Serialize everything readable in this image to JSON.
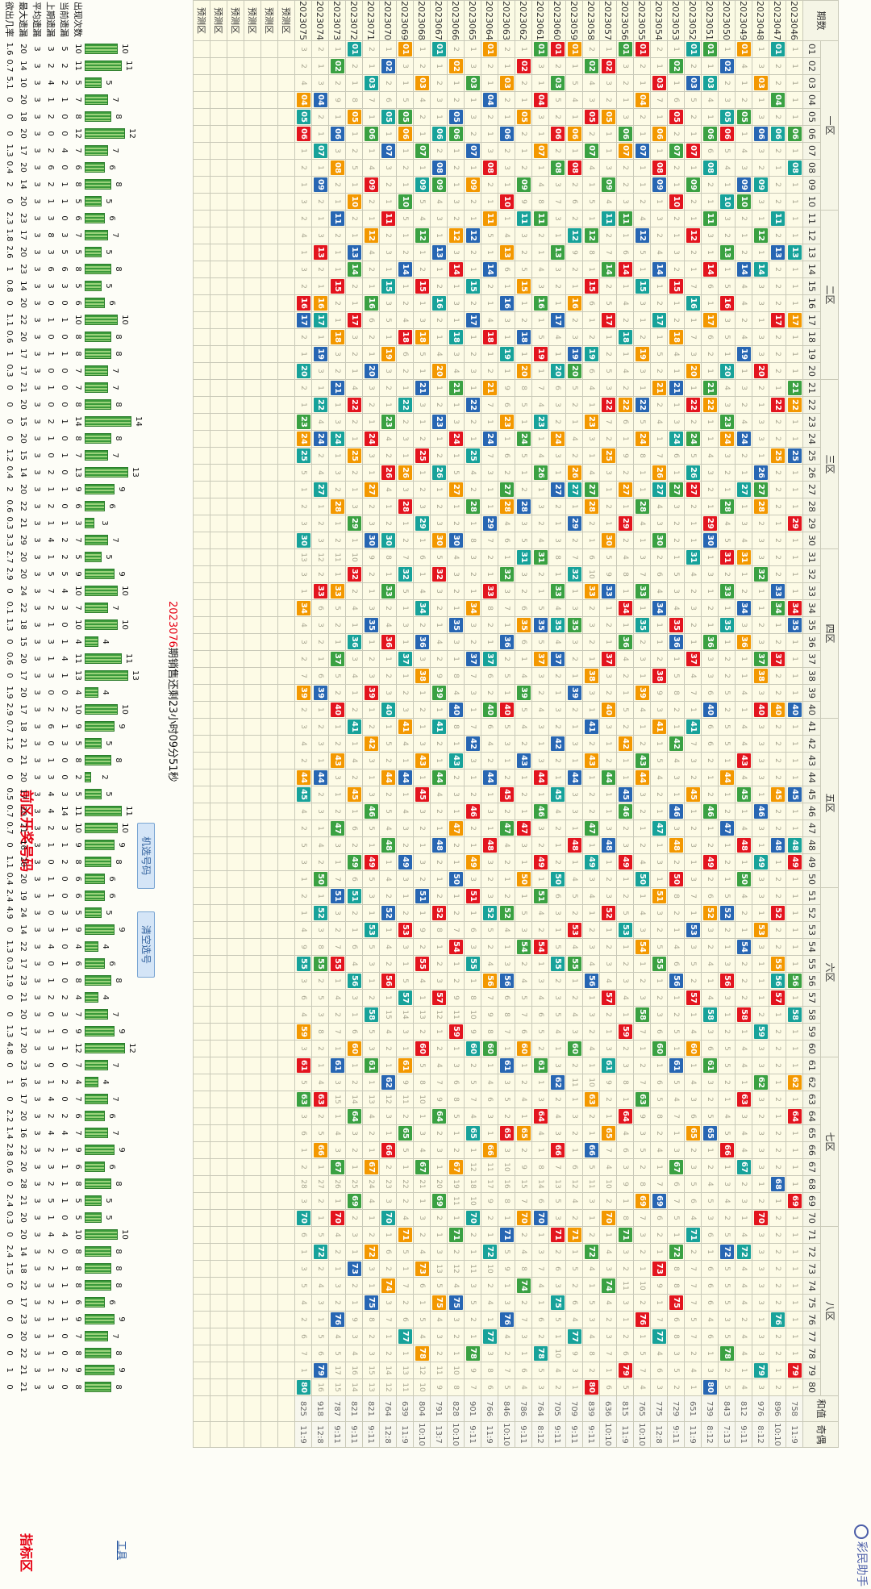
{
  "header": {
    "title": "前区开奖号码",
    "right_title": "指标区",
    "watermark": "彩民助手"
  },
  "columns": {
    "period_label": "期数",
    "zones": [
      "一区",
      "二区",
      "三区",
      "四区",
      "五区",
      "六区",
      "七区",
      "八区"
    ],
    "numbers": [
      "01",
      "02",
      "03",
      "04",
      "05",
      "06",
      "07",
      "08",
      "09",
      "10",
      "11",
      "12",
      "13",
      "14",
      "15",
      "16",
      "17",
      "18",
      "19",
      "20",
      "21",
      "22",
      "23",
      "24",
      "25",
      "26",
      "27",
      "28",
      "29",
      "30",
      "31",
      "32",
      "33",
      "34",
      "35",
      "36",
      "37",
      "38",
      "39",
      "40",
      "41",
      "42",
      "43",
      "44",
      "45",
      "46",
      "47",
      "48",
      "49",
      "50",
      "51",
      "52",
      "53",
      "54",
      "55",
      "56",
      "57",
      "58",
      "59",
      "60",
      "61",
      "62",
      "63",
      "64",
      "65",
      "66",
      "67",
      "68",
      "69",
      "70",
      "71",
      "72",
      "73",
      "74",
      "75",
      "76",
      "77",
      "78",
      "79",
      "80"
    ],
    "sum_label": "和值",
    "odd_label": "奇偶"
  },
  "rows": [
    {
      "period": "2023046",
      "draw": [
        "06",
        "08",
        "13",
        "17",
        "21",
        "22",
        "25",
        "29",
        "34",
        "35",
        "40",
        "45",
        "48",
        "49",
        "56",
        "58",
        "62",
        "64",
        "69",
        "79"
      ],
      "sum": "758",
      "odd": "11:9"
    },
    {
      "period": "2023047",
      "draw": [
        "01",
        "04",
        "06",
        "11",
        "13",
        "17",
        "22",
        "25",
        "33",
        "34",
        "37",
        "40",
        "45",
        "48",
        "52",
        "55",
        "56",
        "57",
        "68",
        "76"
      ],
      "sum": "896",
      "odd": "10:10"
    },
    {
      "period": "2023048",
      "draw": [
        "03",
        "06",
        "09",
        "12",
        "14",
        "20",
        "26",
        "27",
        "28",
        "32",
        "37",
        "38",
        "40",
        "46",
        "49",
        "53",
        "59",
        "62",
        "70",
        "79"
      ],
      "sum": "976",
      "odd": "8:12"
    },
    {
      "period": "2023049",
      "draw": [
        "01",
        "05",
        "09",
        "10",
        "14",
        "19",
        "24",
        "27",
        "31",
        "34",
        "36",
        "43",
        "45",
        "48",
        "50",
        "54",
        "58",
        "63",
        "67",
        "72"
      ],
      "sum": "812",
      "odd": "9:11"
    },
    {
      "period": "2023050",
      "draw": [
        "02",
        "05",
        "06",
        "10",
        "13",
        "16",
        "20",
        "23",
        "24",
        "28",
        "31",
        "33",
        "35",
        "44",
        "47",
        "52",
        "56",
        "66",
        "72",
        "78"
      ],
      "sum": "843",
      "odd": "7:13"
    },
    {
      "period": "2023051",
      "draw": [
        "01",
        "03",
        "06",
        "08",
        "11",
        "14",
        "17",
        "21",
        "22",
        "29",
        "30",
        "36",
        "40",
        "46",
        "49",
        "52",
        "58",
        "61",
        "65",
        "80"
      ],
      "sum": "739",
      "odd": "8:12"
    },
    {
      "period": "2023052",
      "draw": [
        "01",
        "03",
        "07",
        "09",
        "12",
        "16",
        "20",
        "22",
        "24",
        "26",
        "27",
        "31",
        "37",
        "41",
        "45",
        "53",
        "57",
        "60",
        "65",
        "71"
      ],
      "sum": "651",
      "odd": "11:9"
    },
    {
      "period": "2023053",
      "draw": [
        "02",
        "05",
        "07",
        "10",
        "15",
        "18",
        "21",
        "24",
        "27",
        "35",
        "36",
        "42",
        "46",
        "48",
        "50",
        "56",
        "61",
        "67",
        "72",
        "75"
      ],
      "sum": "729",
      "odd": "9:11"
    },
    {
      "period": "2023054",
      "draw": [
        "03",
        "06",
        "08",
        "09",
        "14",
        "17",
        "21",
        "26",
        "27",
        "30",
        "34",
        "38",
        "41",
        "47",
        "51",
        "55",
        "60",
        "69",
        "73",
        "77"
      ],
      "sum": "775",
      "odd": "12:8"
    },
    {
      "period": "2023055",
      "draw": [
        "01",
        "04",
        "07",
        "12",
        "15",
        "19",
        "22",
        "24",
        "28",
        "33",
        "35",
        "39",
        "43",
        "44",
        "50",
        "54",
        "58",
        "63",
        "69",
        "76"
      ],
      "sum": "765",
      "odd": "10:10"
    },
    {
      "period": "2023056",
      "draw": [
        "01",
        "06",
        "07",
        "11",
        "14",
        "18",
        "22",
        "27",
        "29",
        "34",
        "36",
        "42",
        "45",
        "46",
        "49",
        "53",
        "59",
        "64",
        "71",
        "79"
      ],
      "sum": "815",
      "odd": "11:9"
    },
    {
      "period": "2023057",
      "draw": [
        "02",
        "05",
        "09",
        "11",
        "14",
        "17",
        "22",
        "25",
        "30",
        "33",
        "37",
        "40",
        "44",
        "48",
        "52",
        "57",
        "61",
        "65",
        "70",
        "74"
      ],
      "sum": "636",
      "odd": "10:10"
    },
    {
      "period": "2023058",
      "draw": [
        "02",
        "05",
        "07",
        "12",
        "15",
        "19",
        "23",
        "27",
        "28",
        "33",
        "38",
        "41",
        "43",
        "47",
        "49",
        "56",
        "63",
        "66",
        "72",
        "80"
      ],
      "sum": "839",
      "odd": "9:11"
    },
    {
      "period": "2023059",
      "draw": [
        "01",
        "06",
        "08",
        "12",
        "16",
        "19",
        "20",
        "26",
        "27",
        "29",
        "32",
        "35",
        "39",
        "44",
        "48",
        "53",
        "55",
        "60",
        "71",
        "77"
      ],
      "sum": "709",
      "odd": "9:11"
    },
    {
      "period": "2023060",
      "draw": [
        "01",
        "03",
        "06",
        "08",
        "13",
        "17",
        "20",
        "24",
        "27",
        "33",
        "35",
        "37",
        "42",
        "45",
        "50",
        "55",
        "62",
        "66",
        "71",
        "75"
      ],
      "sum": "705",
      "odd": "9:11"
    },
    {
      "period": "2023061",
      "draw": [
        "01",
        "04",
        "07",
        "11",
        "16",
        "19",
        "23",
        "26",
        "31",
        "35",
        "37",
        "44",
        "46",
        "49",
        "51",
        "54",
        "61",
        "64",
        "70",
        "78"
      ],
      "sum": "764",
      "odd": "8:12"
    },
    {
      "period": "2023062",
      "draw": [
        "02",
        "05",
        "09",
        "11",
        "15",
        "18",
        "20",
        "24",
        "28",
        "31",
        "35",
        "39",
        "43",
        "47",
        "50",
        "54",
        "60",
        "65",
        "70",
        "74"
      ],
      "sum": "786",
      "odd": "9:11"
    },
    {
      "period": "2023063",
      "draw": [
        "03",
        "06",
        "10",
        "13",
        "16",
        "19",
        "23",
        "27",
        "28",
        "32",
        "36",
        "40",
        "45",
        "47",
        "52",
        "56",
        "61",
        "65",
        "71",
        "76"
      ],
      "sum": "846",
      "odd": "10:10"
    },
    {
      "period": "2023064",
      "draw": [
        "01",
        "04",
        "08",
        "11",
        "14",
        "18",
        "21",
        "24",
        "29",
        "33",
        "37",
        "40",
        "44",
        "48",
        "52",
        "56",
        "60",
        "66",
        "72",
        "77"
      ],
      "sum": "766",
      "odd": "11:9"
    },
    {
      "period": "2023065",
      "draw": [
        "03",
        "07",
        "09",
        "12",
        "15",
        "17",
        "22",
        "25",
        "28",
        "34",
        "37",
        "42",
        "46",
        "49",
        "51",
        "55",
        "60",
        "65",
        "70",
        "78"
      ],
      "sum": "901",
      "odd": "9:11"
    },
    {
      "period": "2023066",
      "draw": [
        "02",
        "05",
        "06",
        "12",
        "14",
        "18",
        "21",
        "24",
        "27",
        "30",
        "35",
        "40",
        "43",
        "47",
        "50",
        "54",
        "59",
        "67",
        "71",
        "75"
      ],
      "sum": "828",
      "odd": "10:10"
    },
    {
      "period": "2023067",
      "draw": [
        "01",
        "06",
        "08",
        "09",
        "13",
        "16",
        "20",
        "23",
        "26",
        "30",
        "32",
        "39",
        "41",
        "44",
        "48",
        "52",
        "57",
        "64",
        "69",
        "75"
      ],
      "sum": "791",
      "odd": "13:7"
    },
    {
      "period": "2023068",
      "draw": [
        "03",
        "07",
        "09",
        "12",
        "15",
        "18",
        "21",
        "25",
        "29",
        "34",
        "36",
        "38",
        "43",
        "45",
        "51",
        "55",
        "60",
        "67",
        "73",
        "78"
      ],
      "sum": "804",
      "odd": "10:10"
    },
    {
      "period": "2023069",
      "draw": [
        "01",
        "05",
        "06",
        "10",
        "14",
        "18",
        "22",
        "26",
        "28",
        "32",
        "37",
        "41",
        "44",
        "49",
        "53",
        "57",
        "61",
        "65",
        "71",
        "77"
      ],
      "sum": "639",
      "odd": "11:9"
    },
    {
      "period": "2023070",
      "draw": [
        "02",
        "05",
        "07",
        "11",
        "15",
        "19",
        "23",
        "26",
        "30",
        "33",
        "36",
        "40",
        "44",
        "48",
        "52",
        "56",
        "62",
        "66",
        "70",
        "74"
      ],
      "sum": "764",
      "odd": "12:8"
    },
    {
      "period": "2023071",
      "draw": [
        "03",
        "06",
        "09",
        "12",
        "16",
        "20",
        "24",
        "27",
        "30",
        "35",
        "39",
        "42",
        "46",
        "49",
        "53",
        "58",
        "61",
        "67",
        "72",
        "75"
      ],
      "sum": "821",
      "odd": "9:11"
    },
    {
      "period": "2023072",
      "draw": [
        "01",
        "05",
        "10",
        "13",
        "14",
        "17",
        "22",
        "25",
        "29",
        "32",
        "36",
        "41",
        "45",
        "49",
        "51",
        "56",
        "60",
        "64",
        "69",
        "73"
      ],
      "sum": "821",
      "odd": "9:11"
    },
    {
      "period": "2023073",
      "draw": [
        "02",
        "06",
        "08",
        "11",
        "15",
        "18",
        "21",
        "24",
        "28",
        "33",
        "37",
        "40",
        "43",
        "47",
        "51",
        "55",
        "61",
        "67",
        "70",
        "76"
      ],
      "sum": "787",
      "odd": "9:11"
    },
    {
      "period": "2023074",
      "draw": [
        "04",
        "07",
        "09",
        "13",
        "16",
        "17",
        "19",
        "22",
        "24",
        "27",
        "33",
        "39",
        "44",
        "50",
        "52",
        "55",
        "63",
        "66",
        "72",
        "79"
      ],
      "sum": "918",
      "odd": "12:8"
    },
    {
      "period": "2023075",
      "draw": [
        "04",
        "05",
        "06",
        "16",
        "17",
        "20",
        "23",
        "24",
        "25",
        "30",
        "34",
        "39",
        "44",
        "45",
        "55",
        "59",
        "61",
        "63",
        "70",
        "80"
      ],
      "sum": "825",
      "odd": "11:9"
    }
  ],
  "pred_rows": [
    "预测区",
    "预测区",
    "预测区",
    "预测区",
    "预测区",
    "预测区"
  ],
  "stats": {
    "labels": [
      "出现次数",
      "当前遗漏",
      "上期遗漏",
      "平均遗漏",
      "最大遗漏",
      "欲出几率"
    ],
    "counts": [
      10,
      11,
      5,
      7,
      8,
      12,
      7,
      6,
      8,
      5,
      6,
      7,
      5,
      8,
      5,
      6,
      10,
      8,
      8,
      7,
      7,
      8,
      14,
      8,
      7,
      13,
      9,
      6,
      3,
      7,
      5,
      9,
      10,
      7,
      10,
      4,
      11,
      13,
      4,
      10,
      9,
      5,
      8,
      2,
      5,
      11,
      10,
      9,
      8,
      6,
      6,
      5,
      9,
      4,
      6,
      8,
      4,
      7,
      9,
      12,
      7,
      4,
      7,
      6,
      7,
      9,
      6,
      8,
      5,
      5,
      10,
      8,
      8,
      8,
      6,
      9,
      7,
      8,
      9,
      8
    ],
    "current": [
      5,
      2,
      2,
      1,
      0,
      0,
      4,
      0,
      1,
      1,
      0,
      3,
      5,
      6,
      3,
      0,
      1,
      0,
      1,
      0,
      0,
      0,
      1,
      0,
      1,
      0,
      1,
      0,
      1,
      2,
      2,
      5,
      4,
      3,
      0,
      1,
      4,
      1,
      0,
      2,
      1,
      3,
      0,
      0,
      3,
      14,
      3,
      1,
      2,
      0,
      0,
      3,
      1,
      0,
      1,
      0,
      2,
      3,
      0,
      1,
      0,
      2,
      0,
      2,
      4,
      1,
      1,
      1,
      1,
      0,
      4,
      0,
      1,
      1,
      1,
      1,
      0,
      0,
      2,
      0
    ],
    "last": [
      3,
      2,
      4,
      1,
      2,
      0,
      2,
      6,
      2,
      1,
      3,
      8,
      3,
      6,
      3,
      0,
      1,
      0,
      1,
      0,
      1,
      0,
      2,
      1,
      0,
      2,
      1,
      2,
      1,
      4,
      1,
      5,
      7,
      2,
      1,
      3,
      1,
      3,
      0,
      2,
      6,
      0,
      1,
      3,
      4,
      4,
      2,
      1,
      0,
      1,
      1,
      0,
      3,
      4,
      0,
      1,
      2,
      0,
      1,
      3,
      0,
      1,
      4,
      2,
      4,
      2,
      3,
      2,
      5,
      1,
      4,
      2,
      2,
      3,
      2,
      1,
      1,
      1,
      1,
      3
    ],
    "avg": [
      3,
      3,
      3,
      3,
      3,
      3,
      3,
      3,
      3,
      3,
      3,
      3,
      3,
      3,
      3,
      3,
      3,
      3,
      3,
      3,
      3,
      3,
      3,
      3,
      3,
      3,
      3,
      3,
      3,
      3,
      3,
      3,
      3,
      3,
      3,
      3,
      3,
      3,
      3,
      3,
      3,
      3,
      3,
      3,
      3,
      3,
      3,
      3,
      3,
      3,
      3,
      3,
      3,
      3,
      3,
      3,
      3,
      3,
      3,
      3,
      3,
      3,
      3,
      3,
      3,
      3,
      3,
      3,
      3,
      3,
      3,
      3,
      3,
      3,
      3,
      3,
      3,
      3,
      3,
      3
    ],
    "max": [
      20,
      14,
      10,
      20,
      18,
      20,
      17,
      20,
      14,
      20,
      23,
      17,
      20,
      23,
      14,
      20,
      22,
      20,
      17,
      17,
      21,
      20,
      15,
      20,
      15,
      14,
      20,
      22,
      21,
      29,
      20,
      20,
      24,
      22,
      18,
      15,
      20,
      17,
      20,
      17,
      18,
      21,
      21,
      20,
      17,
      20,
      21,
      16,
      20,
      20,
      19,
      24,
      14,
      22,
      17,
      23,
      21,
      20,
      17,
      20,
      23,
      16,
      17,
      20,
      16,
      22,
      20,
      28,
      21,
      20,
      20,
      14,
      18,
      22,
      17,
      23,
      20,
      22,
      21,
      21
    ],
    "odds": [
      "1.6",
      "0.7",
      "5.1",
      "0",
      "0",
      "0",
      "1.3",
      "0.4",
      "2",
      "0",
      "2.3",
      "1.8",
      "2.6",
      "1",
      "0.8",
      "0",
      "1.1",
      "0.6",
      "1",
      "0.3",
      "0",
      "0",
      "0",
      "0",
      "1.2",
      "0.4",
      "2",
      "0.6",
      "0.3",
      "3.3",
      "2.7",
      "2.9",
      "0",
      "0.1",
      "1.3",
      "0",
      "0.6",
      "0",
      "1.9",
      "2.9",
      "0.7",
      "1.2",
      "0",
      "0",
      "0.5",
      "0.7",
      "0.7",
      "0",
      "1.1",
      "0.4",
      "2.4",
      "4.9",
      "0",
      "1.3",
      "0.3",
      "1.9",
      "0",
      "0",
      "1.3",
      "4.8",
      "0",
      "1",
      "0",
      "2.2",
      "1.4",
      "2.8",
      "0.6",
      "0",
      "2.4",
      "0.3",
      "0",
      "2.4",
      "1.5",
      "0",
      "0",
      "0",
      "0",
      "0",
      "1",
      "0"
    ]
  },
  "countdown": {
    "period": "2023076",
    "text": "期销售还剩23小时09分51秒"
  },
  "buttons": {
    "random": "机选号码",
    "clear": "清空选号"
  },
  "tool_link": "工具",
  "colors": {
    "green": "#3aa142",
    "teal": "#17a29a",
    "blue": "#2766b3",
    "orange": "#f39800",
    "red": "#e3141e"
  }
}
